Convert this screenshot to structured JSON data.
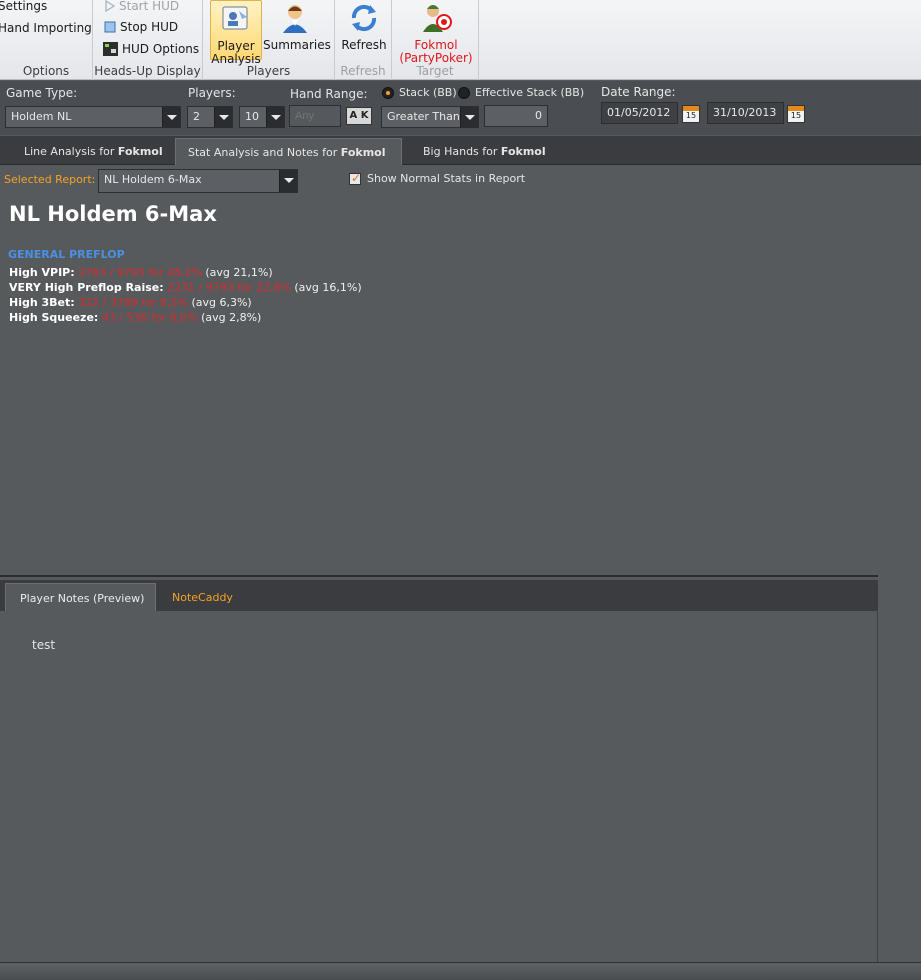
{
  "ribbon": {
    "options": {
      "settings": "Settings",
      "hand_importing": "Hand Importing",
      "label": "Options"
    },
    "hud": {
      "start": "Start HUD",
      "stop": "Stop HUD",
      "options": "HUD Options",
      "label": "Heads-Up Display"
    },
    "players": {
      "player_analysis": "Player Analysis",
      "summaries": "Summaries",
      "label": "Players"
    },
    "refresh": {
      "button": "Refresh",
      "label": "Refresh"
    },
    "target": {
      "name": "Fokmol",
      "site": "(PartyPoker)",
      "label": "Target"
    }
  },
  "filters": {
    "game_type_label": "Game Type:",
    "game_type": "Holdem NL",
    "players_label": "Players:",
    "players_min": "2",
    "players_max": "10",
    "hand_range_label": "Hand Range:",
    "hand_range_placeholder": "Any",
    "hand_range_button": "A K",
    "stack_label": "Stack (BB)",
    "effective_stack_label": "Effective Stack (BB)",
    "comparison": "Greater Than",
    "stack_value": "0",
    "date_range_label": "Date Range:",
    "date_from": "01/05/2012",
    "date_to": "31/10/2013",
    "cal_day": "15"
  },
  "tabs": [
    {
      "label": "Line Analysis for ",
      "player": "Fokmol"
    },
    {
      "label": "Stat Analysis and Notes for ",
      "player": "Fokmol"
    },
    {
      "label": "Big Hands for ",
      "player": "Fokmol"
    }
  ],
  "report": {
    "selected_label": "Selected Report:",
    "selected_value": "NL Holdem 6-Max",
    "show_normal_stats": "Show Normal Stats in Report",
    "title": "NL Holdem 6-Max",
    "section": "GENERAL PREFLOP",
    "stats": [
      {
        "label": "High VPIP:",
        "value": "2763 / 9793 for 28,2%",
        "avg": "(avg 21,1%)"
      },
      {
        "label": "VERY High Preflop Raise:",
        "value": "2231 / 9793 for 22,8%",
        "avg": "(avg 16,1%)"
      },
      {
        "label": "High 3Bet:",
        "value": "322 / 3789 for 8,5%",
        "avg": "(avg 6,3%)"
      },
      {
        "label": "High Squeeze:",
        "value": "43 / 536 for 8,0%",
        "avg": "(avg 2,8%)"
      }
    ]
  },
  "notes": {
    "tab_preview": "Player Notes (Preview)",
    "tab_notecaddy": "NoteCaddy",
    "text": "test"
  }
}
